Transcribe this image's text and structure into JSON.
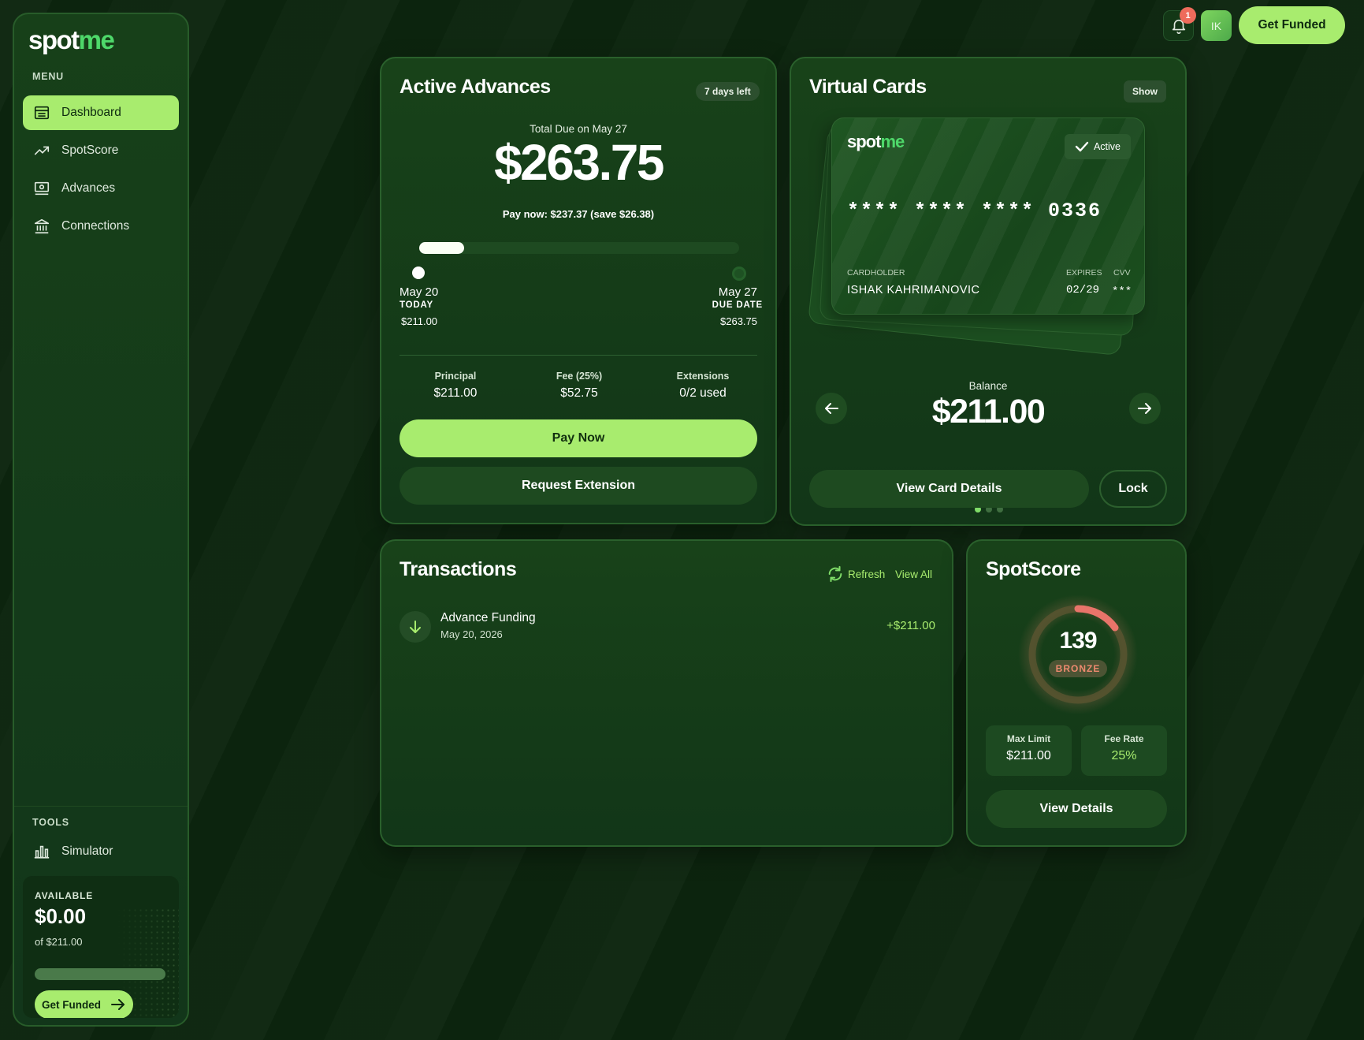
{
  "brand": {
    "logo_spot": "spot",
    "logo_me": "me"
  },
  "sidebar": {
    "menu_label": "MENU",
    "items": [
      {
        "label": "Dashboard",
        "icon": "dashboard-icon",
        "active": true
      },
      {
        "label": "SpotScore",
        "icon": "trending-up-icon",
        "active": false
      },
      {
        "label": "Advances",
        "icon": "advances-icon",
        "active": false
      },
      {
        "label": "Connections",
        "icon": "bank-icon",
        "active": false
      }
    ],
    "tools_label": "TOOLS",
    "tools": [
      {
        "label": "Simulator",
        "icon": "bar-chart-icon"
      }
    ],
    "available": {
      "label": "AVAILABLE",
      "amount": "$0.00",
      "of_text": "of $211.00",
      "fill_fraction": 0,
      "button_label": "Get Funded"
    }
  },
  "header": {
    "notification_count": "1",
    "avatar_initials": "IK",
    "get_funded_label": "Get Funded"
  },
  "active_advances": {
    "title": "Active Advances",
    "days_left": "7 days left",
    "total_due_label": "Total Due on May 27",
    "total_due": "$263.75",
    "pay_now_text": "Pay now: $237.37 (save $26.38)",
    "progress_fraction": 0.14,
    "start": {
      "date": "May 20",
      "label": "TODAY",
      "amount": "$211.00"
    },
    "end": {
      "date": "May 27",
      "label": "DUE DATE",
      "amount": "$263.75"
    },
    "stats": [
      {
        "label": "Principal",
        "value": "$211.00"
      },
      {
        "label": "Fee (25%)",
        "value": "$52.75"
      },
      {
        "label": "Extensions",
        "value": "0/2 used"
      }
    ],
    "pay_now_button": "Pay Now",
    "extension_button": "Request Extension"
  },
  "virtual_cards": {
    "title": "Virtual Cards",
    "show_label": "Show",
    "card": {
      "logo_spot": "spot",
      "logo_me": "me",
      "status": "Active",
      "number": "**** **** **** 0336",
      "cardholder_label": "CARDHOLDER",
      "cardholder_name": "ISHAK KAHRIMANOVIC",
      "expires_label": "EXPIRES",
      "expires_value": "02/29",
      "cvv_label": "CVV",
      "cvv_value": "***"
    },
    "balance_label": "Balance",
    "balance": "$211.00",
    "page_count": 3,
    "active_page": 1,
    "view_details_button": "View Card Details",
    "lock_button": "Lock"
  },
  "transactions": {
    "title": "Transactions",
    "refresh_label": "Refresh",
    "view_all_label": "View All",
    "items": [
      {
        "title": "Advance Funding",
        "date": "May 20, 2026",
        "amount": "+$211.00",
        "icon": "arrow-down-icon"
      }
    ]
  },
  "spotscore": {
    "title": "SpotScore",
    "score": "139",
    "tier": "BRONZE",
    "ring_fraction": 0.15,
    "max_limit_label": "Max Limit",
    "max_limit_value": "$211.00",
    "fee_rate_label": "Fee Rate",
    "fee_rate_value": "25%",
    "view_details_button": "View Details"
  },
  "colors": {
    "accent": "#a8ec6e",
    "brand_green": "#4ed86a",
    "background": "#0d260f",
    "panel": "#174019",
    "alert": "#ee6b5b",
    "bronze": "#e8846f"
  }
}
